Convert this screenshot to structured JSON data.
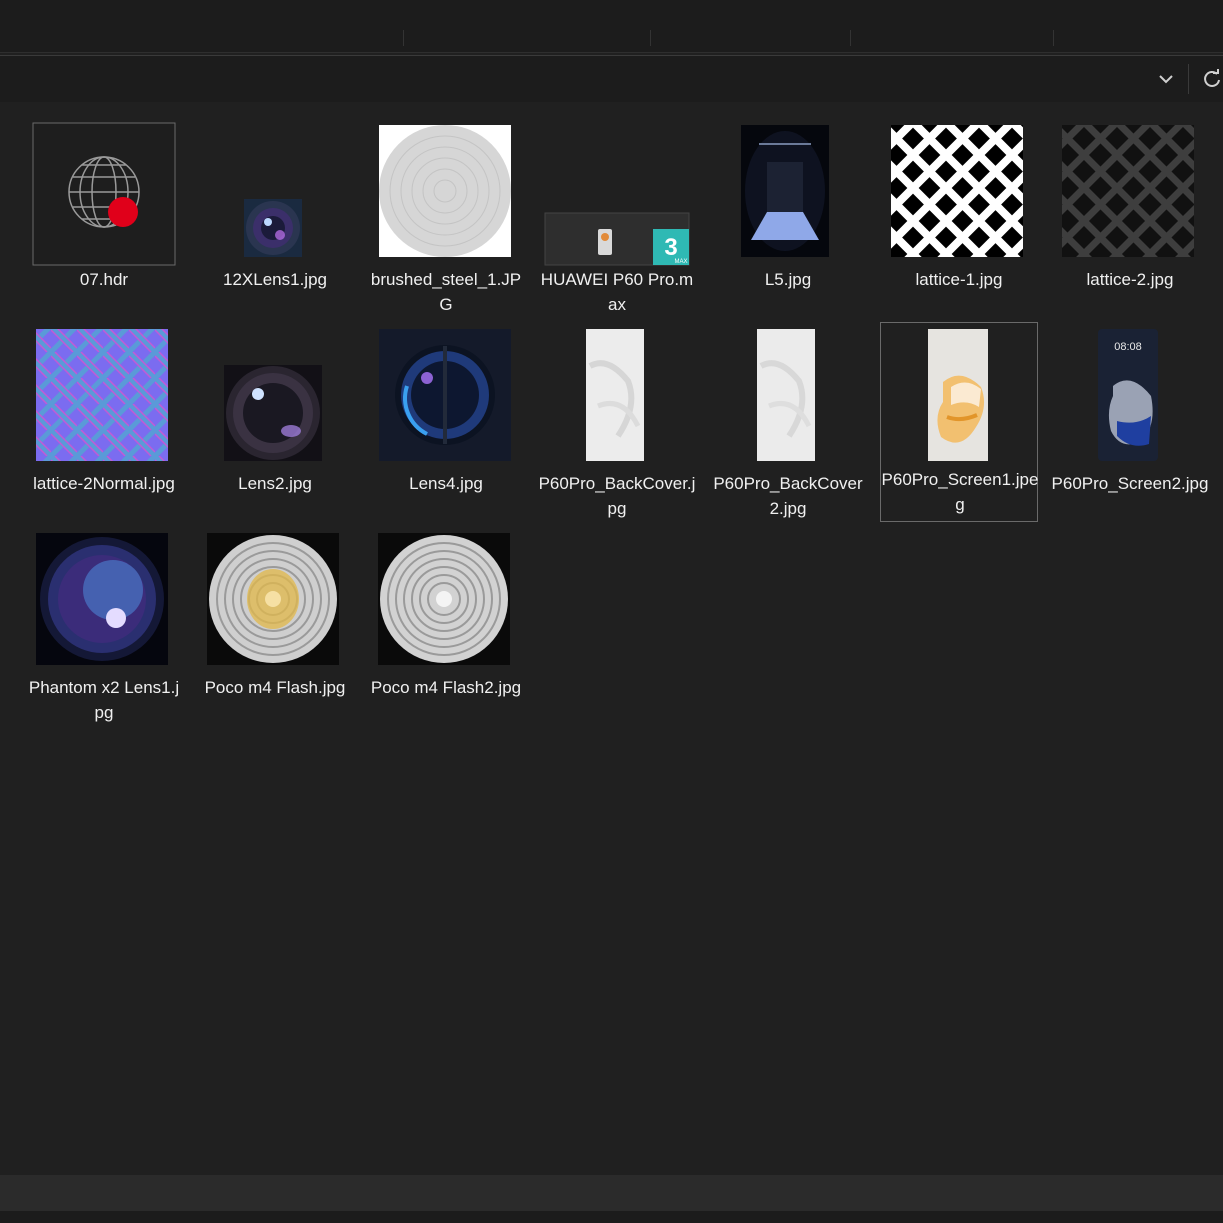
{
  "toolbar": {
    "dropdown_icon": "chevron-down-icon",
    "refresh_icon": "refresh-icon"
  },
  "files": [
    {
      "name": "07.hdr",
      "selected": false
    },
    {
      "name": "12XLens1.jpg",
      "selected": false
    },
    {
      "name": "brushed_steel_1.JPG",
      "selected": false
    },
    {
      "name": "HUAWEI P60 Pro.max",
      "selected": false
    },
    {
      "name": "L5.jpg",
      "selected": false
    },
    {
      "name": "lattice-1.jpg",
      "selected": false
    },
    {
      "name": "lattice-2.jpg",
      "selected": false
    },
    {
      "name": "lattice-2Normal.jpg",
      "selected": false
    },
    {
      "name": "Lens2.jpg",
      "selected": false
    },
    {
      "name": "Lens4.jpg",
      "selected": false
    },
    {
      "name": "P60Pro_BackCover.jpg",
      "selected": false
    },
    {
      "name": "P60Pro_BackCover2.jpg",
      "selected": false
    },
    {
      "name": "P60Pro_Screen1.jpeg",
      "selected": true
    },
    {
      "name": "P60Pro_Screen2.jpg",
      "selected": false
    },
    {
      "name": "Phantom x2 Lens1.jpg",
      "selected": false
    },
    {
      "name": "Poco m4 Flash.jpg",
      "selected": false
    },
    {
      "name": "Poco m4 Flash2.jpg",
      "selected": false
    }
  ],
  "thumb_texts": {
    "max_badge_number": "3",
    "max_badge_text": "MAX",
    "screen2_clock": "08:08"
  },
  "colors": {
    "background": "#202020",
    "hdr_sphere_red": "#e0001a",
    "normal_map_purple": "#7b6cf0",
    "max_badge_teal": "#2fb9b4"
  }
}
